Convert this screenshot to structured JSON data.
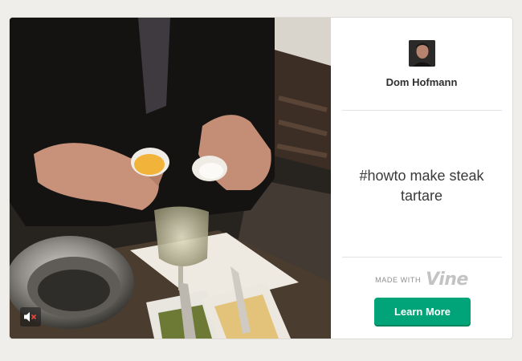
{
  "video": {
    "mute_icon": "muted-speaker-icon"
  },
  "profile": {
    "username": "Dom Hofmann"
  },
  "post": {
    "caption": "#howto make steak tartare"
  },
  "footer": {
    "made_with_label": "MADE WITH",
    "brand_name": "Vine",
    "learn_more_label": "Learn More"
  },
  "colors": {
    "accent": "#00a478",
    "background": "#efeeea",
    "card": "#ffffff"
  }
}
